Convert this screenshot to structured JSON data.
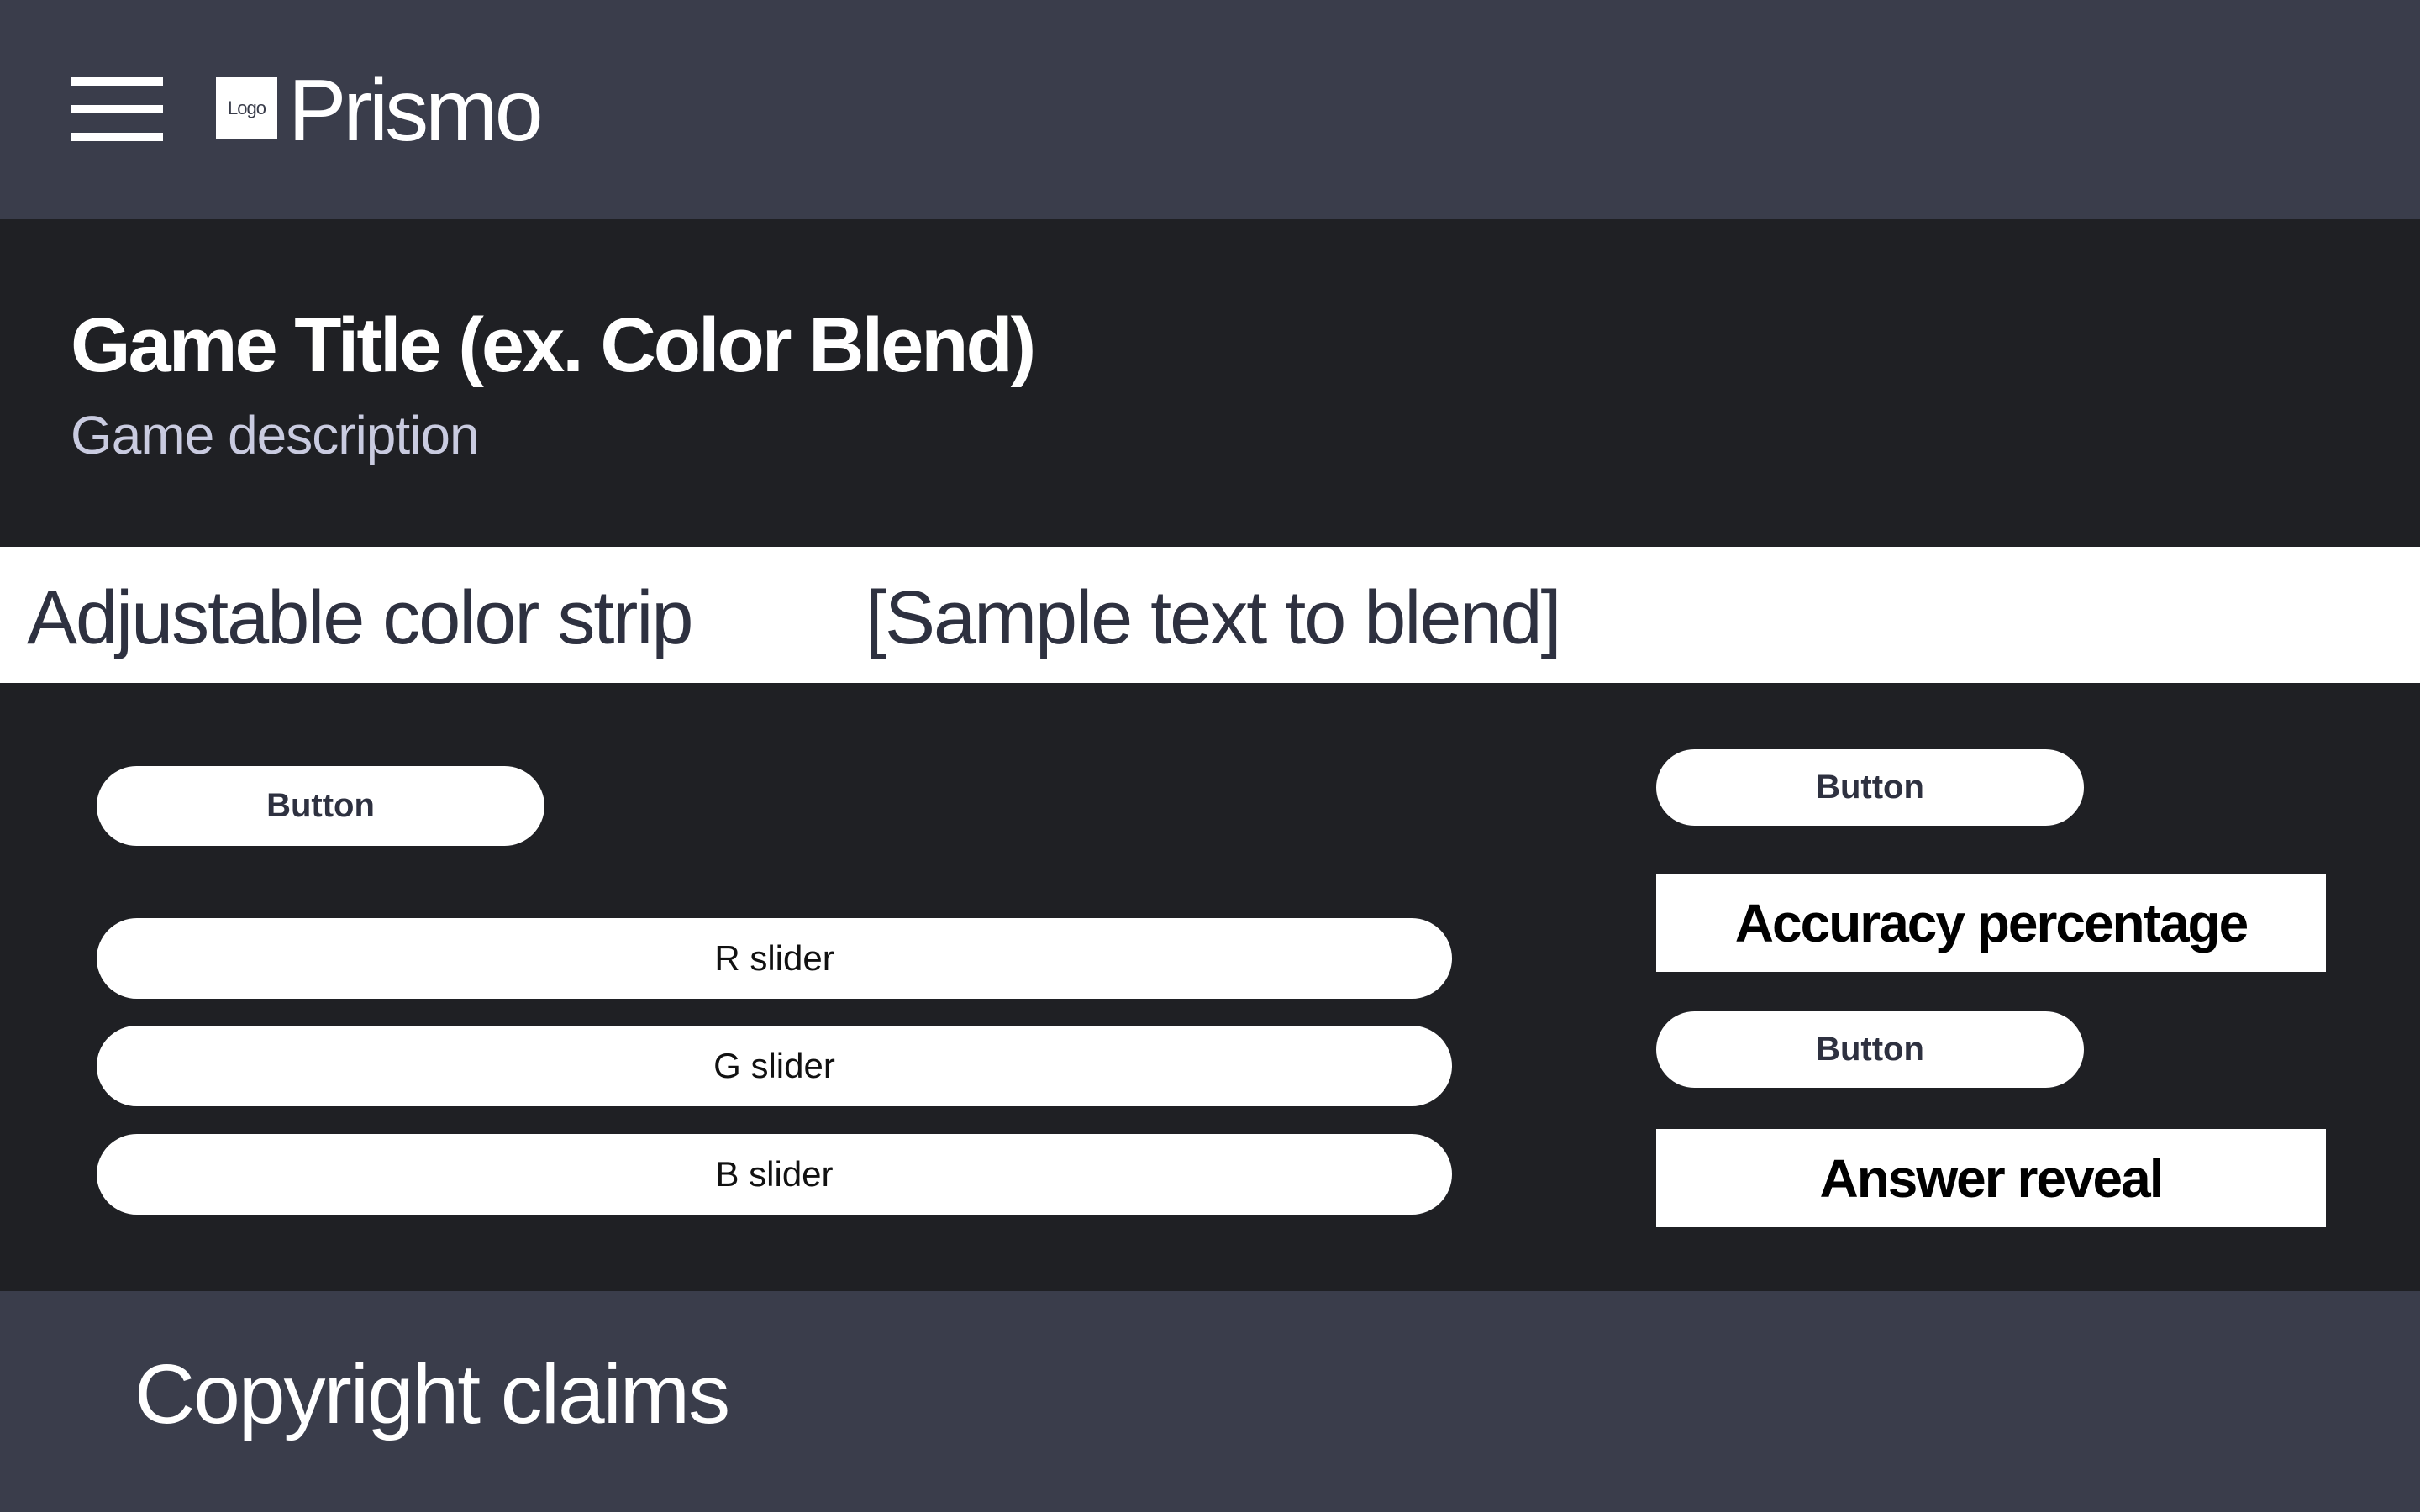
{
  "header": {
    "menu_icon": "hamburger-menu-icon",
    "logo_label": "Logo",
    "brand_name": "Prismo"
  },
  "hero": {
    "title": "Game Title (ex. Color Blend)",
    "description": "Game description"
  },
  "strip": {
    "label": "Adjustable color strip",
    "sample_text": "[Sample text to blend]"
  },
  "controls": {
    "left_button_label": "Button",
    "sliders": [
      {
        "label": "R slider"
      },
      {
        "label": "G slider"
      },
      {
        "label": "B slider"
      }
    ],
    "right_button_1_label": "Button",
    "accuracy_label": "Accuracy percentage",
    "right_button_2_label": "Button",
    "answer_label": "Answer reveal"
  },
  "footer": {
    "copyright": "Copyright claims"
  },
  "colors": {
    "header_bg": "#3a3d4b",
    "body_bg": "#1f2024",
    "strip_bg": "#ffffff",
    "text_light": "#ffffff",
    "text_muted": "#c9cbe0"
  }
}
